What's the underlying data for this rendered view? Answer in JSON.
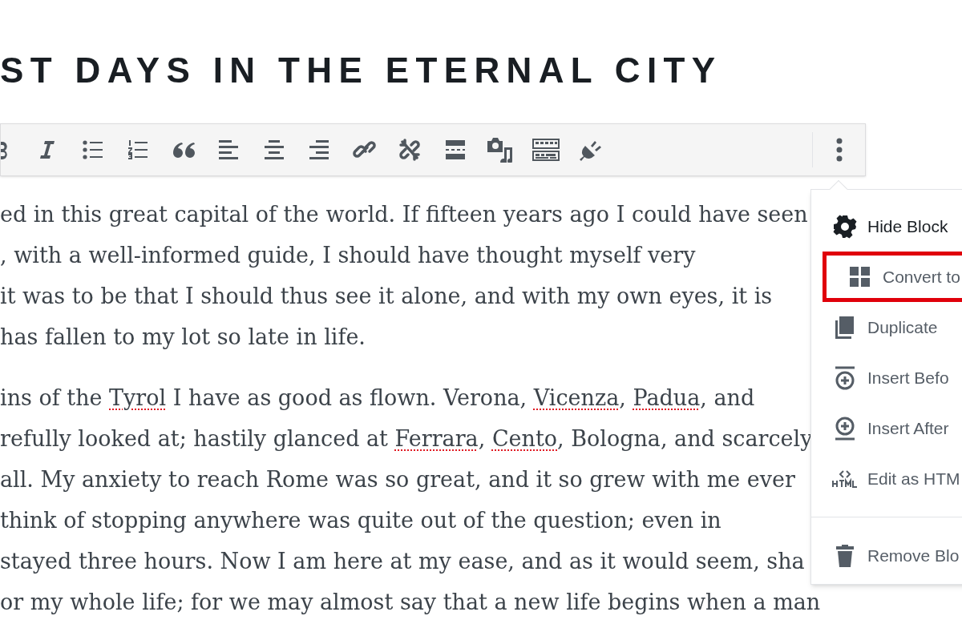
{
  "title": "ST DAYS IN THE ETERNAL CITY",
  "toolbar": {
    "buttons": [
      {
        "kind": "bold"
      },
      {
        "kind": "italic"
      },
      {
        "kind": "bullet-list"
      },
      {
        "kind": "numbered-list"
      },
      {
        "kind": "quote"
      },
      {
        "kind": "align-left"
      },
      {
        "kind": "align-center"
      },
      {
        "kind": "align-right"
      },
      {
        "kind": "link"
      },
      {
        "kind": "unlink"
      },
      {
        "kind": "read-more"
      },
      {
        "kind": "media"
      },
      {
        "kind": "toolbar-toggle"
      },
      {
        "kind": "plugin"
      }
    ],
    "more_menu_open": true
  },
  "paragraphs": [
    [
      [
        {
          "text": "ed in this great capital of the world. If fifteen years ago I could have seen"
        }
      ],
      [
        {
          "text": ", with a well-informed guide, I should have thought myself very"
        }
      ],
      [
        {
          "text": "it was to be that I should thus see it alone, and with my own eyes, it is"
        }
      ],
      [
        {
          "text": "has fallen to my lot so late in life."
        }
      ]
    ],
    [
      [
        {
          "text": "ins of the "
        },
        {
          "text": "Tyrol",
          "misspelled": true
        },
        {
          "text": " I have as good as flown. Verona, "
        },
        {
          "text": "Vicenza",
          "misspelled": true
        },
        {
          "text": ", "
        },
        {
          "text": "Padua",
          "misspelled": true
        },
        {
          "text": ", and"
        }
      ],
      [
        {
          "text": "refully looked at; hastily glanced at "
        },
        {
          "text": "Ferrara",
          "misspelled": true
        },
        {
          "text": ", "
        },
        {
          "text": "Cento",
          "misspelled": true
        },
        {
          "text": ", Bologna, and scarcely"
        }
      ],
      [
        {
          "text": "all. My anxiety to reach Rome was so great, and it so grew with me ever"
        }
      ],
      [
        {
          "text": "think of stopping anywhere was quite out of the question; even in"
        }
      ],
      [
        {
          "text": "stayed three hours. Now I am here at my ease, and as it would seem, sha"
        }
      ],
      [
        {
          "text": "or my whole life; for we may almost say that a new life begins when a man"
        }
      ]
    ]
  ],
  "menu": {
    "groups": [
      [
        {
          "kind": "gear",
          "label": "Hide Block",
          "hovered": true,
          "highlighted": false
        },
        {
          "kind": "grid",
          "label": "Convert to",
          "hovered": false,
          "highlighted": true
        },
        {
          "kind": "duplicate",
          "label": "Duplicate",
          "hovered": false,
          "highlighted": false
        },
        {
          "kind": "insert-before",
          "label": "Insert Befo",
          "hovered": false,
          "highlighted": false
        },
        {
          "kind": "insert-after",
          "label": "Insert After",
          "hovered": false,
          "highlighted": false
        },
        {
          "kind": "html",
          "label": "Edit as HTM",
          "hovered": false,
          "highlighted": false
        }
      ],
      [
        {
          "kind": "trash",
          "label": "Remove Blo",
          "hovered": false,
          "highlighted": false
        }
      ]
    ]
  }
}
